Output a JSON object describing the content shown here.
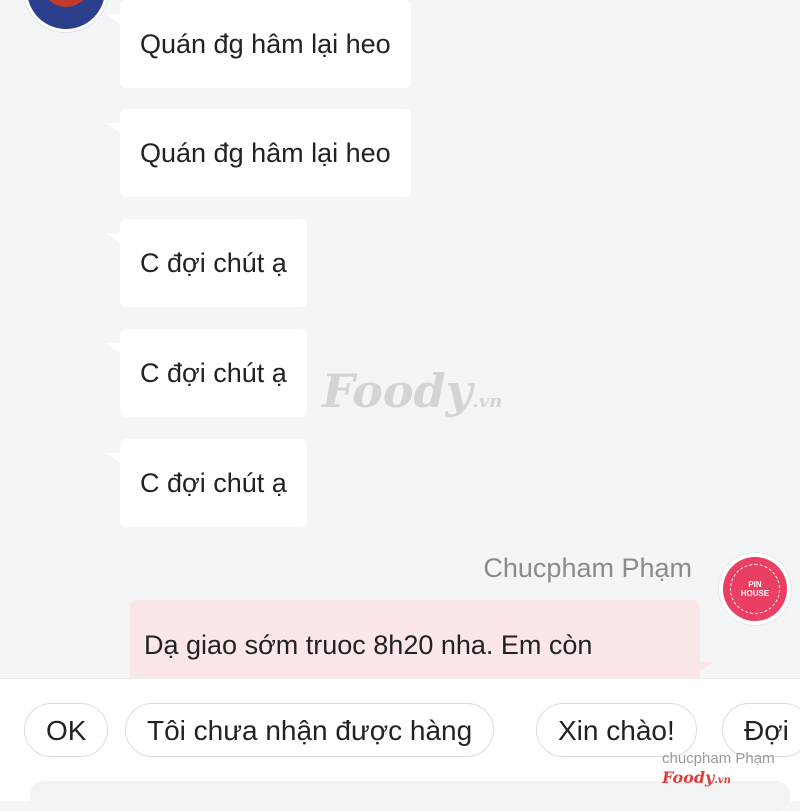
{
  "watermark": {
    "brand": "Foody",
    "suffix": ".vn"
  },
  "messages_in": [
    {
      "text": "Quán đg hâm lại heo"
    },
    {
      "text": "Quán đg hâm lại heo"
    },
    {
      "text": "C đợi chút ạ"
    },
    {
      "text": "C đợi chút ạ"
    },
    {
      "text": "C đợi chút ạ"
    }
  ],
  "outgoing": {
    "sender": "Chucpham Phạm",
    "avatar_text_line1": "PIN",
    "avatar_text_line2": "HOUSE",
    "text": "Dạ giao sớm truoc 8h20 nha. Em còn"
  },
  "quick_replies": [
    {
      "label": "OK"
    },
    {
      "label": "Tôi chưa nhận được hàng"
    },
    {
      "label": "Xin chào!"
    },
    {
      "label": "Đợi"
    }
  ],
  "footer": {
    "user": "chucpham Phạm",
    "brand": "Foody",
    "suffix": ".vn"
  },
  "colors": {
    "background": "#f4f5f7",
    "incoming_bubble": "#ffffff",
    "outgoing_bubble": "#fbe6e8",
    "shop_avatar": "#ea3e62"
  }
}
